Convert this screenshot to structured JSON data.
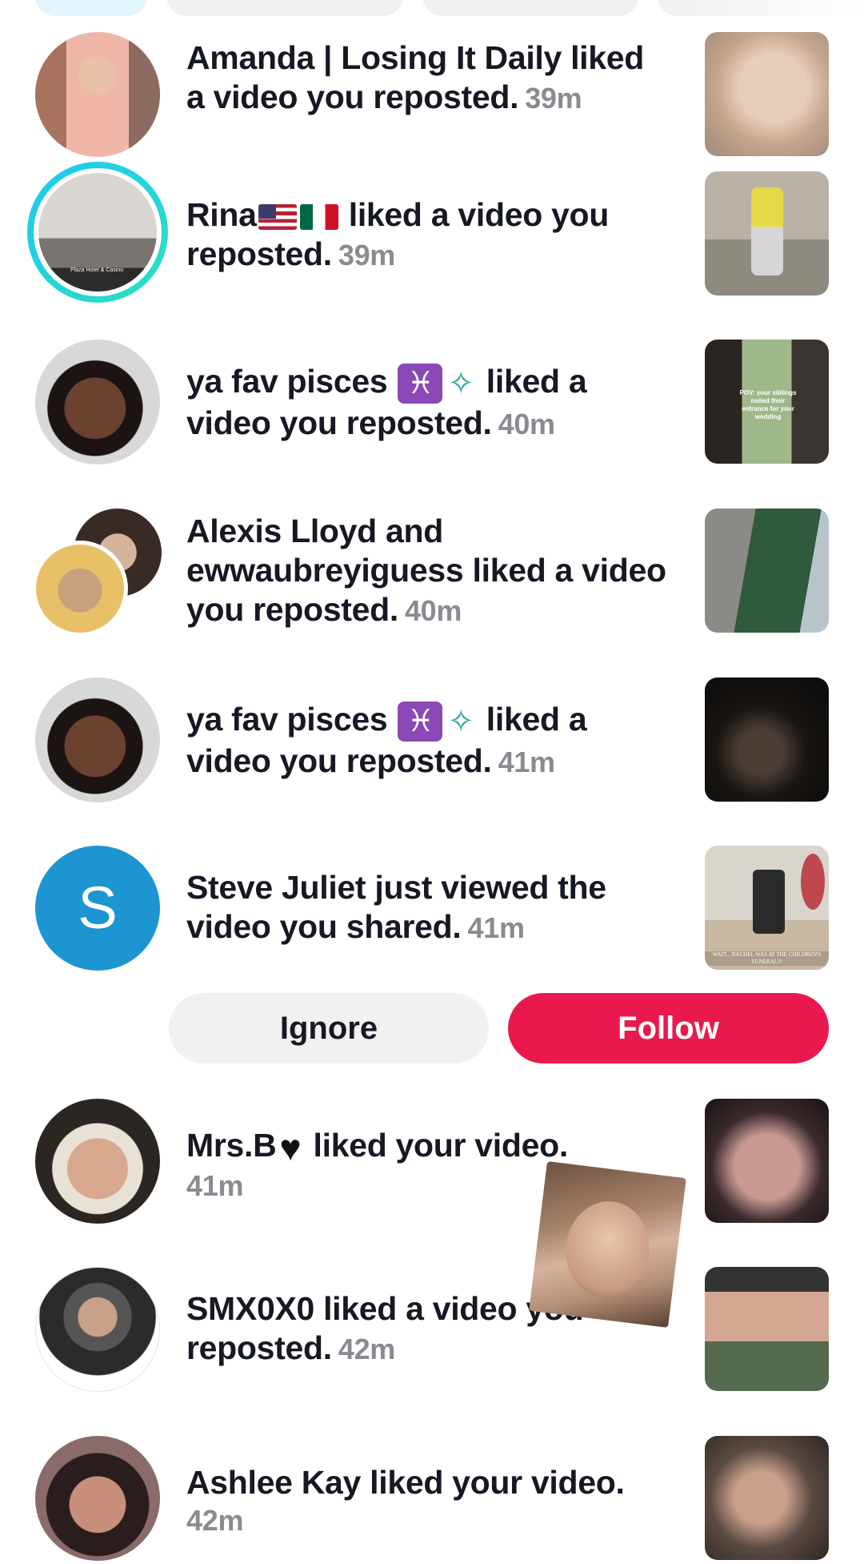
{
  "filters": [
    "",
    "",
    "",
    ""
  ],
  "notifications": [
    {
      "text": "Amanda | Losing It Daily liked a video you reposted.",
      "time": "39m",
      "avatar_color": "#d8a79a",
      "thumb_color": "#c9b2a0"
    },
    {
      "name": "Rina",
      "flags": [
        "us-flag",
        "mexico-flag"
      ],
      "text": "liked a video you reposted.",
      "time": "39m",
      "avatar_caption": "Plaza Hotel & Casino",
      "story_ring_color": "#29c6e8",
      "thumb_color": "#c7b894"
    },
    {
      "name": "ya fav pisces",
      "badge": "♓",
      "text": "liked a video you reposted.",
      "time": "40m",
      "thumb_caption": "POV: your siblings nailed their entrance for your wedding"
    },
    {
      "text": "Alexis Lloyd and ewwaubreyiguess liked a video you reposted.",
      "time": "40m"
    },
    {
      "name": "ya fav pisces",
      "badge": "♓",
      "text": "liked a video you reposted.",
      "time": "41m"
    },
    {
      "avatar_initial": "S",
      "text": "Steve Juliet just viewed the video you shared.",
      "time": "41m",
      "thumb_caption": "WAIT... RACHEL WAS AT THE CHILDREN'S FUNERAL?!"
    },
    {
      "name": "Mrs.B",
      "text": "liked your video.",
      "time": "41m"
    },
    {
      "text": "SMX0X0 liked a video you reposted.",
      "time": "42m"
    },
    {
      "text": "Ashlee Kay liked your video.",
      "time": "42m"
    }
  ],
  "actions": {
    "ignore": "Ignore",
    "follow": "Follow"
  },
  "colors": {
    "follow": "#e9194e",
    "ignore_bg": "#f1f1f2",
    "time": "#8a8b91",
    "avatar_s": "#1d95d0"
  }
}
